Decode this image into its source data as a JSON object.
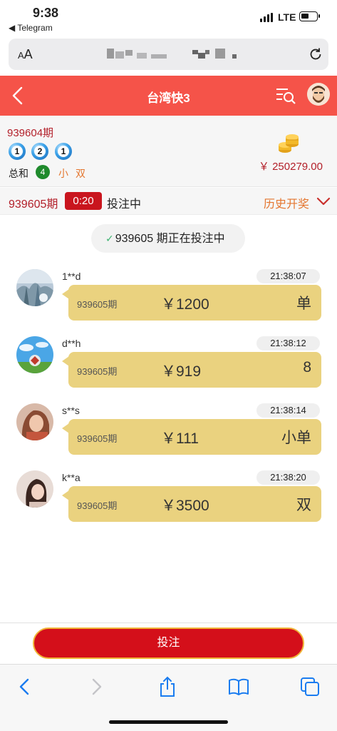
{
  "status_bar": {
    "time": "9:38",
    "back_app": "◀ Telegram",
    "network": "LTE"
  },
  "address_bar": {
    "text_size_label": "AA",
    "url_obscured": true
  },
  "header": {
    "title": "台湾快3",
    "colors": {
      "background": "#f55349",
      "text": "#ffffff"
    }
  },
  "last_draw": {
    "period": "939604期",
    "balls": [
      "1",
      "2",
      "1"
    ],
    "sum_label": "总和",
    "sum_value": "4",
    "size": "小",
    "odd_even": "双",
    "balance": "￥ 250279.00"
  },
  "current": {
    "period": "939605期",
    "countdown": "0:20",
    "state": "投注中",
    "history_label": "历史开奖"
  },
  "notice": {
    "text": "939605 期正在投注中"
  },
  "bets": [
    {
      "user": "1**d",
      "time": "21:38:07",
      "period": "939605期",
      "amount": "￥1200",
      "pick": "单"
    },
    {
      "user": "d**h",
      "time": "21:38:12",
      "period": "939605期",
      "amount": "￥919",
      "pick": "8"
    },
    {
      "user": "s**s",
      "time": "21:38:14",
      "period": "939605期",
      "amount": "￥111",
      "pick": "小单"
    },
    {
      "user": "k**a",
      "time": "21:38:20",
      "period": "939605期",
      "amount": "￥3500",
      "pick": "双"
    }
  ],
  "bet_button": {
    "label": "投注"
  },
  "colors": {
    "accent_red": "#d40f1a",
    "period_red": "#b3202a",
    "orange": "#e4762f",
    "bubble": "#ead27f",
    "sum_green": "#1f8a2c"
  }
}
